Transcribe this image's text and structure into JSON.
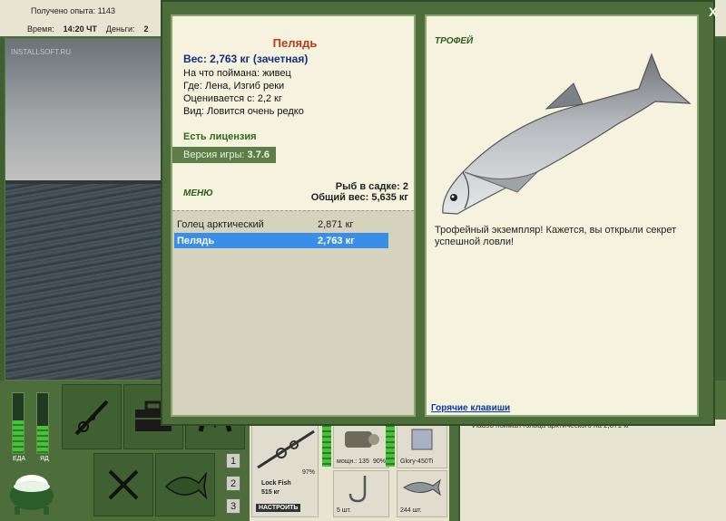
{
  "topbar": {
    "exp_label": "Получено опыта:",
    "exp_value": "1143",
    "time_label": "Время:",
    "time_value": "14:20 ЧТ",
    "money_label": "Деньги:",
    "money_value": "2"
  },
  "scene": {
    "watermark": "INSTALLSOFT.RU"
  },
  "status": {
    "food_label": "ЕДА",
    "yd_label": "ЯД",
    "food_level": 0.55,
    "yd_level": 0.45
  },
  "quick_slots": [
    "1",
    "2",
    "3"
  ],
  "gear": {
    "rod_name": "Lock Fish",
    "rod_length": "515 кг",
    "rod_pct": "97%",
    "setup_button": "НАСТРОИТЬ",
    "reel_power": "мощн.: 135",
    "reel_pct": "90%",
    "line_name": "Glory-450Ti",
    "hooks_count": "5 шт.",
    "bait_count": "244 шт."
  },
  "chat": {
    "message": "Vlad53 поймал гольца арктического на 2,871 кг"
  },
  "dialog": {
    "close_label": "X",
    "fish_name": "Пелядь",
    "fish_weight": "Вес: 2,763 кг (зачетная)",
    "caught_on": "На что поймана: живец",
    "location": "Где: Лена, Изгиб реки",
    "value_from": "Оценивается с: 2,2 кг",
    "rarity": "Вид: Ловится очень редко",
    "license": "Есть лицензия",
    "version_label": "Версия игры:",
    "version_value": "3.7.6",
    "menu_label": "МЕНЮ",
    "cage_count": "Рыб в садке: 2",
    "total_weight": "Общий вес: 5,635 кг",
    "catch_list": [
      {
        "name": "Голец арктический",
        "weight": "2,871 кг",
        "selected": false
      },
      {
        "name": "Пелядь",
        "weight": "2,763 кг",
        "selected": true
      }
    ],
    "trophy_label": "ТРОФЕЙ",
    "trophy_text": "Трофейный экземпляр! Кажется, вы открыли секрет успешной ловли!",
    "hotkeys_link": "Горячие клавиши"
  },
  "colors": {
    "panel_bg": "#f5f3de",
    "frame_green": "#4d6e3a",
    "fish_name": "#b83a16",
    "weight_blue": "#122e86",
    "selected_row": "#3a8ee8"
  }
}
